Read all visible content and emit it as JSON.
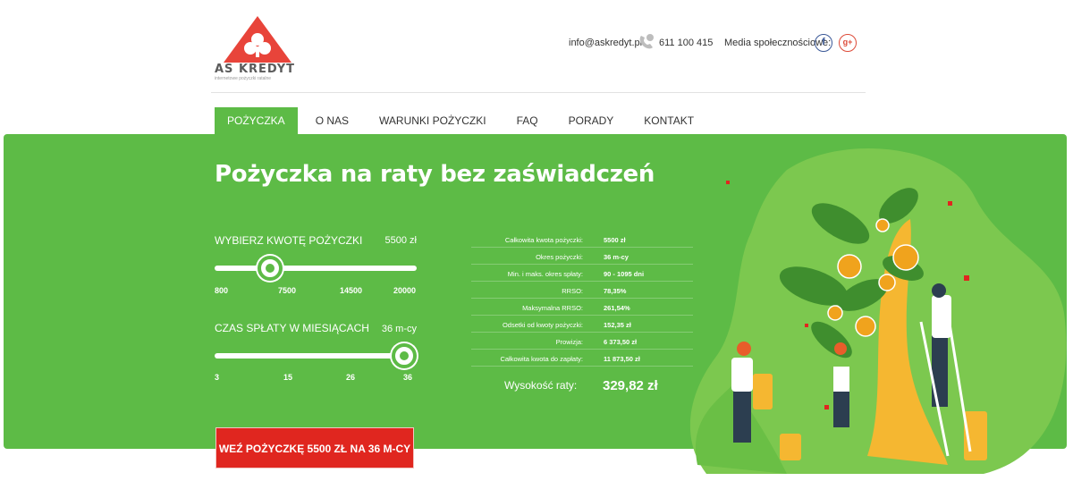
{
  "header": {
    "logo_text": "AS KREDYT",
    "logo_subtitle": "internetowe pożyczki ratalne",
    "email": "info@askredyt.pl",
    "phone": "611 100 415",
    "social_label": "Media społecznościowe:",
    "facebook_glyph": "f",
    "googleplus_glyph": "g+"
  },
  "nav": {
    "items": [
      {
        "label": "POŻYCZKA",
        "active": true
      },
      {
        "label": "O NAS"
      },
      {
        "label": "WARUNKI POŻYCZKI"
      },
      {
        "label": "FAQ"
      },
      {
        "label": "PORADY"
      },
      {
        "label": "KONTAKT"
      }
    ]
  },
  "hero": {
    "title": "Pożyczka na raty bez zaświadczeń",
    "amount_slider": {
      "label": "WYBIERZ KWOTĘ POŻYCZKI",
      "value_text": "5500 zł",
      "ticks": [
        "800",
        "7500",
        "14500",
        "20000"
      ]
    },
    "term_slider": {
      "label": "CZAS SPŁATY W MIESIĄCACH",
      "value_text": "36 m-cy",
      "ticks": [
        "3",
        "15",
        "26",
        "36"
      ]
    },
    "summary": [
      {
        "key": "Całkowita kwota pożyczki:",
        "value": "5500 zł"
      },
      {
        "key": "Okres pożyczki:",
        "value": "36 m-cy"
      },
      {
        "key": "Min. i maks. okres spłaty:",
        "value": "90 - 1095 dni"
      },
      {
        "key": "RRSO:",
        "value": "78,35%"
      },
      {
        "key": "Maksymalna RRSO:",
        "value": "261,54%"
      },
      {
        "key": "Odsetki od kwoty pożyczki:",
        "value": "152,35 zł"
      },
      {
        "key": "Prowizja:",
        "value": "6 373,50 zł"
      },
      {
        "key": "Całkowita kwota do zapłaty:",
        "value": "11 873,50 zł"
      }
    ],
    "installment_label": "Wysokość raty:",
    "installment_value": "329,82 zł",
    "cta_label": "WEŹ POŻYCZKĘ 5500 ZŁ NA 36 M-CY"
  },
  "colors": {
    "brand_green": "#5dbb46",
    "cta_red": "#e0261f",
    "logo_red": "#e8443a"
  }
}
